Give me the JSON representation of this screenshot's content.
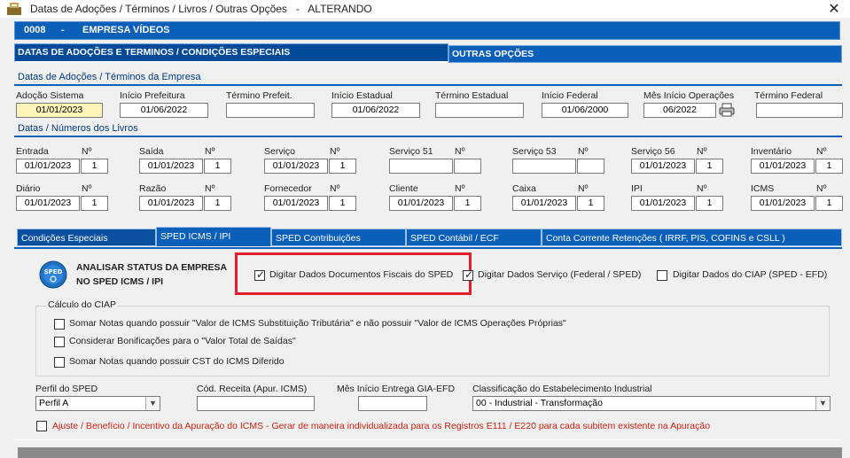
{
  "window": {
    "title": "Datas de Adoções / Términos / Livros / Outras Opções   -   ALTERANDO",
    "close": "✕"
  },
  "company": {
    "code": "0008",
    "sep": "-",
    "name": "EMPRESA VÍDEOS"
  },
  "tabs": {
    "main": "DATAS DE ADOÇÕES E TERMINOS / CONDIÇÕES ESPECIAIS",
    "other": "OUTRAS OPÇÕES"
  },
  "adocoes": {
    "heading": "Datas de Adoções / Términos da Empresa",
    "fields": [
      {
        "label": "Adoção Sistema",
        "value": "01/01/2023"
      },
      {
        "label": "Início Prefeitura",
        "value": "01/06/2022"
      },
      {
        "label": "Término Prefeit.",
        "value": ""
      },
      {
        "label": "Início Estadual",
        "value": "01/06/2022"
      },
      {
        "label": "Término Estadual",
        "value": ""
      },
      {
        "label": "Início Federal",
        "value": "01/06/2000"
      },
      {
        "label": "Mês Início Operações",
        "value": "06/2022"
      },
      {
        "label": "Término Federal",
        "value": ""
      }
    ]
  },
  "livros": {
    "heading": "Datas / Números dos Livros",
    "num_label": "Nº",
    "row1": [
      {
        "label": "Entrada",
        "date": "01/01/2023",
        "num": "1"
      },
      {
        "label": "Saída",
        "date": "01/01/2023",
        "num": "1"
      },
      {
        "label": "Serviço",
        "date": "01/01/2023",
        "num": "1"
      },
      {
        "label": "Serviço 51",
        "date": "",
        "num": ""
      },
      {
        "label": "Serviço 53",
        "date": "",
        "num": ""
      },
      {
        "label": "Serviço 56",
        "date": "01/01/2023",
        "num": "1"
      },
      {
        "label": "Inventário",
        "date": "01/01/2023",
        "num": "1"
      }
    ],
    "row2": [
      {
        "label": "Diário",
        "date": "01/01/2023",
        "num": "1"
      },
      {
        "label": "Razão",
        "date": "01/01/2023",
        "num": "1"
      },
      {
        "label": "Fornecedor",
        "date": "01/01/2023",
        "num": "1"
      },
      {
        "label": "Cliente",
        "date": "01/01/2023",
        "num": "1"
      },
      {
        "label": "Caixa",
        "date": "01/01/2023",
        "num": "1"
      },
      {
        "label": "IPI",
        "date": "01/01/2023",
        "num": "1"
      },
      {
        "label": "ICMS",
        "date": "01/01/2023",
        "num": "1"
      }
    ]
  },
  "subtabs": [
    "Condições Especiais",
    "SPED ICMS / IPI",
    "SPED Contribuições",
    "SPED Contábil / ECF",
    "Conta Corrente Retenções ( IRRF,  PIS,  COFINS  e  CSLL )"
  ],
  "sped": {
    "logo": "SPED",
    "analisar_line1": "ANALISAR STATUS DA EMPRESA",
    "analisar_line2": "NO SPED ICMS / IPI",
    "chk_docs": "Digitar Dados Documentos Fiscais do SPED",
    "chk_servico": "Digitar Dados Serviço (Federal / SPED)",
    "chk_ciap": "Digitar Dados do CIAP (SPED - EFD)"
  },
  "ciap": {
    "title": "Cálculo do CIAP",
    "opts": [
      "Somar Notas quando possuir \"Valor de ICMS Substituição Tributária\" e não possuir \"Valor de ICMS Operações Próprias\"",
      "Considerar Bonificações para o \"Valor Total de Saídas\"",
      "Somar Notas quando possuir CST do ICMS Diferido"
    ]
  },
  "bottom": {
    "perfil_label": "Perfil do SPED",
    "perfil_value": "Perfil A",
    "cod_label": "Cód. Receita (Apur. ICMS)",
    "cod_value": "",
    "mes_label": "Mês Início Entrega GIA-EFD",
    "mes_value": "",
    "class_label": "Classificação do Estabelecimento Industrial",
    "class_value": "00 - Industrial - Transformação",
    "ajuste": "Ajuste / Benefício / Incentivo da Apuração do ICMS - Gerar de maneira individualizada para os Registros E111 / E220 para cada subitem existente na Apuração"
  },
  "colors": {
    "accent": "#0a5fb8",
    "heading": "#003a8c",
    "highlight": "#e0202a",
    "warning_text": "#d02010"
  }
}
